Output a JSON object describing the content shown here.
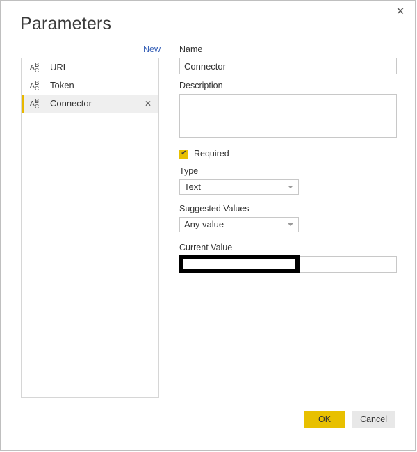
{
  "window": {
    "title": "Parameters",
    "close_label": "✕"
  },
  "left_pane": {
    "new_link": "New",
    "items": [
      {
        "icon": "abc-text-type-icon",
        "label": "URL",
        "selected": false
      },
      {
        "icon": "abc-text-type-icon",
        "label": "Token",
        "selected": false
      },
      {
        "icon": "abc-text-type-icon",
        "label": "Connector",
        "selected": true,
        "delete_glyph": "✕"
      }
    ],
    "icon_glyphs": {
      "a": "A",
      "b": "B",
      "c": "C"
    }
  },
  "form": {
    "name_label": "Name",
    "name_value": "Connector",
    "name_placeholder": "",
    "description_label": "Description",
    "description_value": "",
    "description_placeholder": "",
    "required_label": "Required",
    "required_checked": true,
    "required_tick": "✔",
    "type_label": "Type",
    "type_value": "Text",
    "suggested_values_label": "Suggested Values",
    "suggested_values_value": "Any value",
    "current_value_label": "Current Value",
    "current_value_value": "",
    "current_value_redacted": true
  },
  "footer": {
    "ok_label": "OK",
    "cancel_label": "Cancel"
  },
  "colors": {
    "accent_yellow": "#e8c000",
    "selection_bar": "#e8b800",
    "link_blue": "#3a63b8",
    "border_gray": "#c8c8c8",
    "redaction_black": "#000000"
  }
}
